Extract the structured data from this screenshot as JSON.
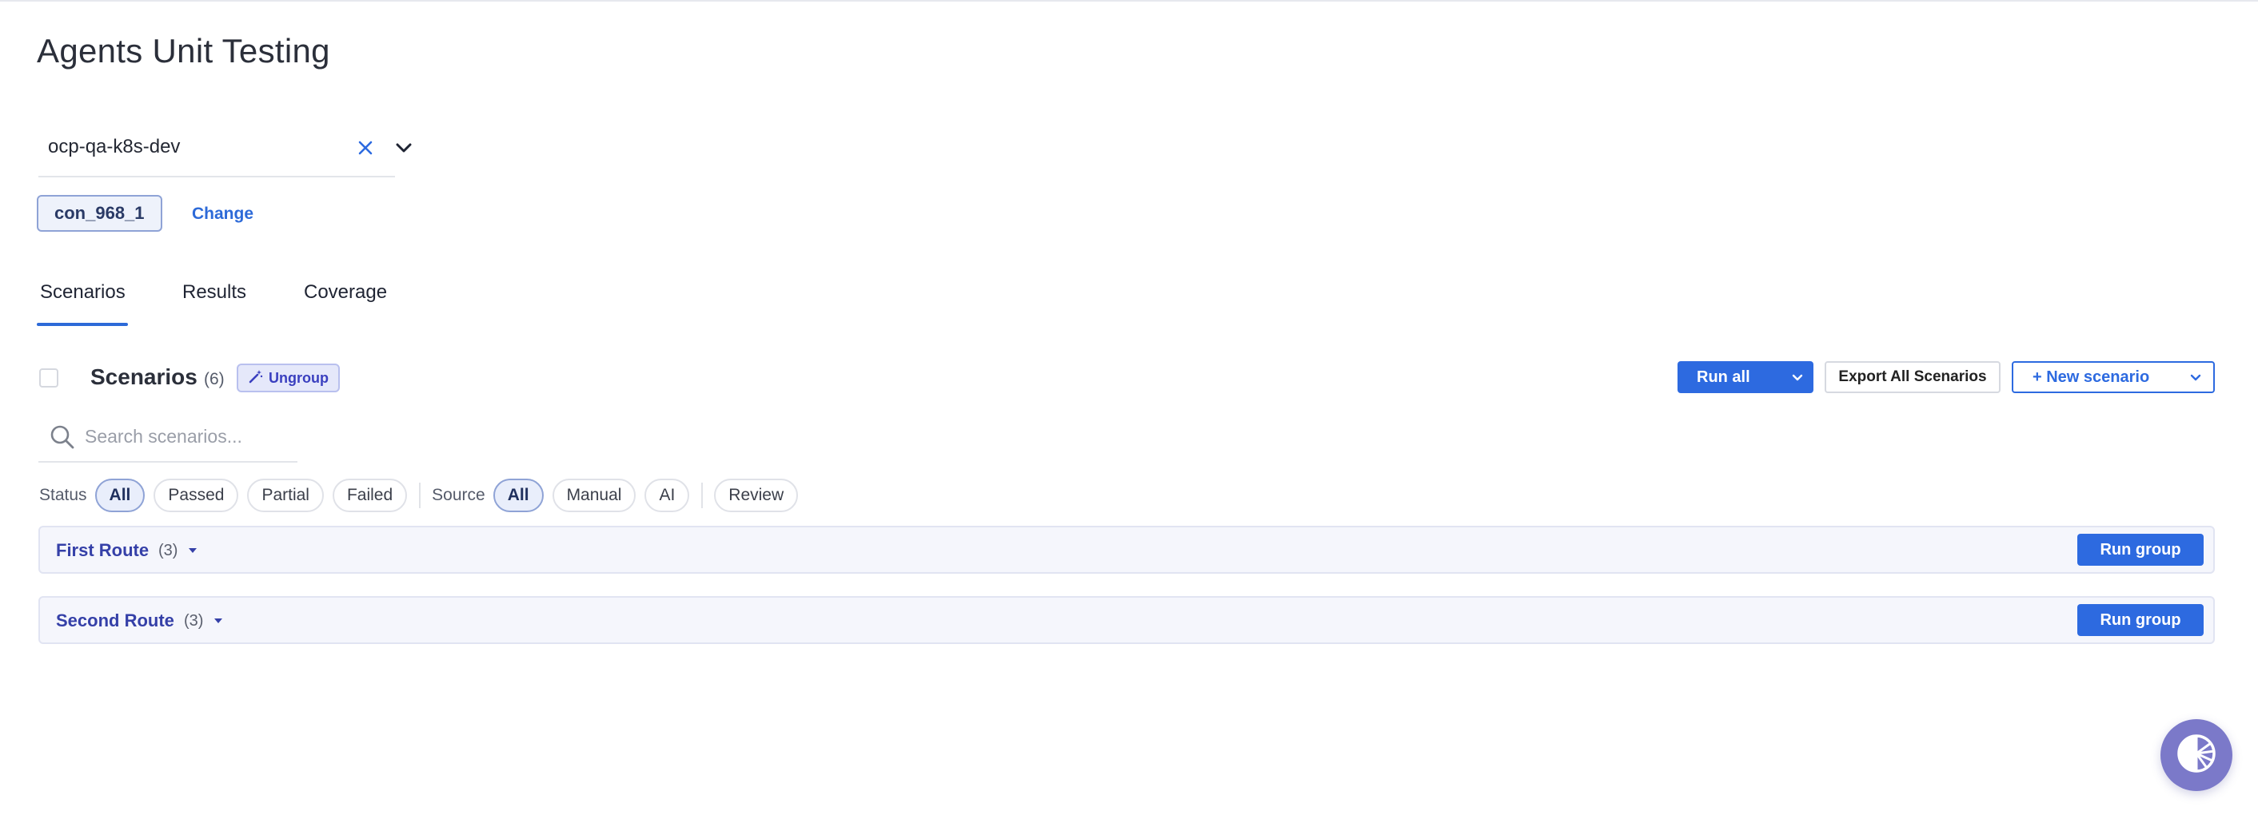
{
  "page": {
    "title": "Agents Unit Testing"
  },
  "workspace": {
    "value": "ocp-qa-k8s-dev"
  },
  "connection": {
    "chip_label": "con_968_1",
    "change_label": "Change"
  },
  "tabs": [
    {
      "label": "Scenarios",
      "active": true
    },
    {
      "label": "Results",
      "active": false
    },
    {
      "label": "Coverage",
      "active": false
    }
  ],
  "scenarios": {
    "title": "Scenarios",
    "count": "(6)",
    "ungroup_label": "Ungroup"
  },
  "toolbar": {
    "run_all_label": "Run all",
    "export_label": "Export All Scenarios",
    "new_scenario_label": "+ New scenario"
  },
  "search": {
    "placeholder": "Search scenarios..."
  },
  "filters": {
    "status_label": "Status",
    "status_options": [
      "All",
      "Passed",
      "Partial",
      "Failed"
    ],
    "status_selected": "All",
    "source_label": "Source",
    "source_options": [
      "All",
      "Manual",
      "AI"
    ],
    "source_selected": "All",
    "review_label": "Review"
  },
  "groups": [
    {
      "name": "First Route",
      "count": "(3)",
      "run_label": "Run group"
    },
    {
      "name": "Second Route",
      "count": "(3)",
      "run_label": "Run group"
    }
  ],
  "colors": {
    "accent": "#2d6ae0",
    "group_title": "#3540a8",
    "group_bg": "#f5f6fc",
    "fab": "#7b79c9"
  },
  "icons": {
    "clear": "close-icon",
    "dropdown": "chevron-down-icon",
    "search": "search-icon",
    "ungroup": "magic-wand-icon",
    "assistant": "assistant-icon"
  }
}
